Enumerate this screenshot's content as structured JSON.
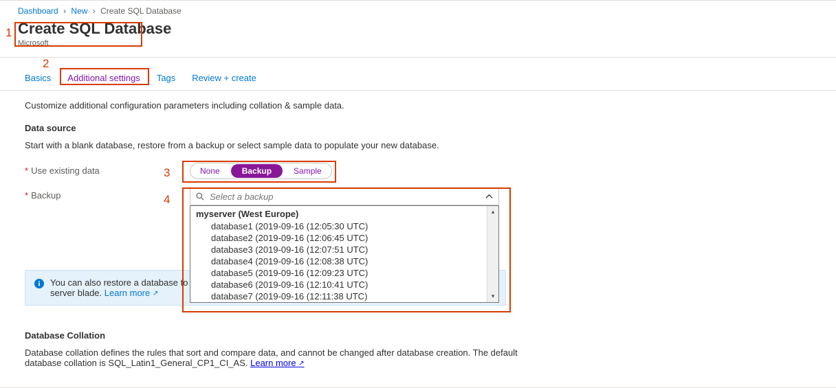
{
  "breadcrumb": {
    "items": [
      "Dashboard",
      "New",
      "Create SQL Database"
    ]
  },
  "header": {
    "title": "Create SQL Database",
    "subtitle": "Microsoft"
  },
  "tabs": {
    "items": [
      "Basics",
      "Additional settings",
      "Tags",
      "Review + create"
    ],
    "active_index": 1
  },
  "intro": "Customize additional configuration parameters including collation & sample data.",
  "data_source": {
    "title": "Data source",
    "desc": "Start with a blank database, restore from a backup or select sample data to populate your new database.",
    "use_existing_label": "Use existing data",
    "options": [
      "None",
      "Backup",
      "Sample"
    ],
    "selected_index": 1,
    "backup_label": "Backup",
    "combo_placeholder": "Select a backup",
    "dropdown": {
      "group": "myserver (West Europe)",
      "items": [
        "database1 (2019-09-16 (12:05:30 UTC)",
        "database2 (2019-09-16 (12:06:45 UTC)",
        "database3 (2019-09-16 (12:07:51 UTC)",
        "database4 (2019-09-16 (12:08:38 UTC)",
        "database5 (2019-09-16 (12:09:23 UTC)",
        "database6 (2019-09-16 (12:10:41 UTC)",
        "database7 (2019-09-16 (12:11:38 UTC)"
      ]
    },
    "callout": {
      "text_a": "You can also restore a database to a ",
      "text_b": "server blade. ",
      "link": "Learn more"
    }
  },
  "collation": {
    "title": "Database Collation",
    "desc_a": "Database collation defines the rules that sort and compare data, and cannot be changed after database creation. The default database collation is SQL_Latin1_General_CP1_CI_AS. ",
    "link": "Learn more"
  },
  "annotations": {
    "n1": "1",
    "n2": "2",
    "n3": "3",
    "n4": "4"
  }
}
